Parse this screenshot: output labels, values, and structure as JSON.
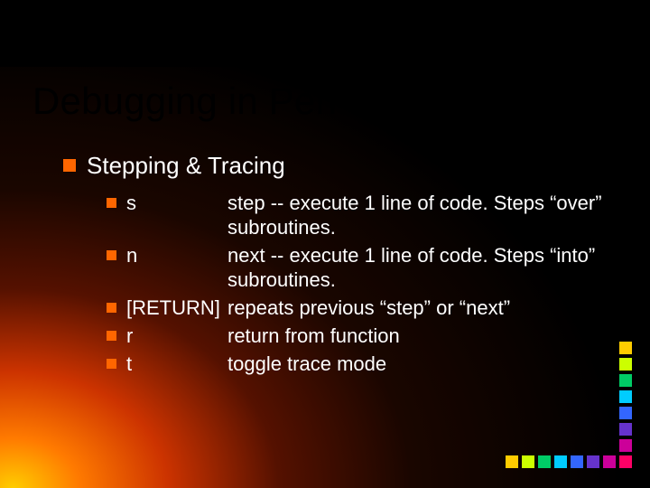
{
  "title": "Debugging in Perl",
  "section": "Stepping & Tracing",
  "items": [
    {
      "cmd": "s",
      "desc": "step -- execute 1 line of code. Steps “over” subroutines."
    },
    {
      "cmd": "n",
      "desc": "next -- execute 1 line of code. Steps “into” subroutines."
    },
    {
      "cmd": "[RETURN]",
      "desc": "repeats previous “step” or “next”"
    },
    {
      "cmd": "r",
      "desc": "return from function"
    },
    {
      "cmd": "t",
      "desc": "toggle trace mode"
    }
  ]
}
